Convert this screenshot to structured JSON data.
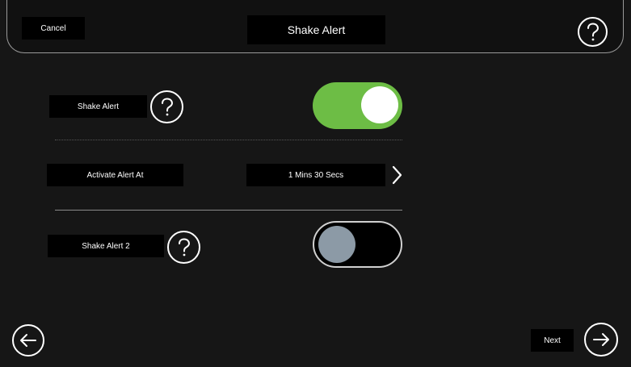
{
  "header": {
    "cancel_label": "Cancel",
    "title": "Shake Alert",
    "help_icon": "question-mark-icon"
  },
  "settings": {
    "shake_alert": {
      "label": "Shake Alert",
      "enabled": true,
      "help_icon": "question-mark-icon"
    },
    "activate_alert_at": {
      "label": "Activate Alert At",
      "value": "1 Mins 30 Secs",
      "chevron_icon": "chevron-right-icon"
    },
    "shake_alert_2": {
      "label": "Shake Alert 2",
      "enabled": false,
      "help_icon": "question-mark-icon"
    }
  },
  "footer": {
    "back_icon": "arrow-left-icon",
    "next_label": "Next",
    "next_icon": "arrow-right-icon"
  },
  "colors": {
    "background": "#161616",
    "toggle_on": "#6dbd45",
    "toggle_off_knob": "#8c9aa6",
    "label_bg": "#000000",
    "text": "#ffffff"
  }
}
